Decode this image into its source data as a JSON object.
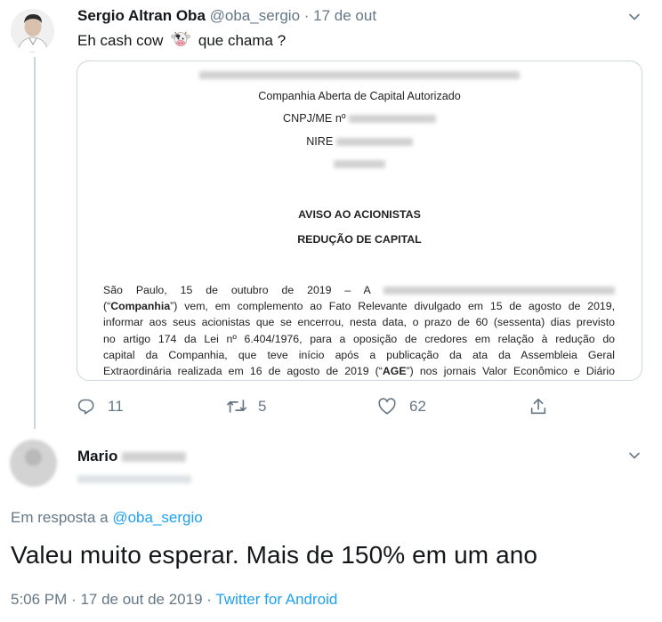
{
  "tweet": {
    "author_name": "Sergio Altran Oba",
    "author_handle": "@oba_sergio",
    "separator": "·",
    "date": "17 de out",
    "text_before": "Eh cash cow",
    "text_emoji": "cow-face-emoji",
    "text_after": "que chama ?",
    "document": {
      "line_company_type": "Companhia Aberta de Capital Autorizado",
      "line_cnpj_label": "CNPJ/ME nº",
      "line_nire_label": "NIRE",
      "heading_1": "AVISO AO ACIONISTAS",
      "heading_2": "REDUÇÃO DE CAPITAL",
      "body_l1_a": "São Paulo, 15 de outubro de 2019 – A",
      "body_l2_open": "(“",
      "body_l2_bold": "Companhia",
      "body_l2_rest": "”) vem, em complemento ao Fato Relevante divulgado em 15 de agosto de 2019,",
      "body_l3": "informar aos seus acionistas que se encerrou, nesta data, o prazo de 60 (sessenta) dias previsto",
      "body_l4": "no artigo 174 da Lei nº 6.404/1976, para a oposição de credores em relação à redução do",
      "body_l5": "capital da Companhia, que teve início após a publicação da ata da Assembleia Geral",
      "body_l6_a": "Extraordinária realizada em 16 de agosto de 2019 (“",
      "body_l6_bold": "AGE",
      "body_l6_b": "”) nos jornais Valor Econômico e Diário"
    },
    "actions": {
      "replies": "11",
      "retweets": "5",
      "likes": "62"
    }
  },
  "reply": {
    "author_name_visible": "Mario",
    "in_reply_prefix": "Em resposta a",
    "in_reply_handle": "@oba_sergio",
    "text": "Valeu muito esperar. Mais de 150% em um ano",
    "time": "5:06 PM",
    "separator": "·",
    "date": "17 de out de 2019",
    "source": "Twitter for Android"
  },
  "colors": {
    "text_primary": "#14171a",
    "text_secondary": "#657786",
    "link": "#1da1f2",
    "border": "#ccd6dd"
  },
  "icons": {
    "reply": "reply-icon",
    "retweet": "retweet-icon",
    "like": "heart-icon",
    "share": "share-icon",
    "menu": "chevron-down-icon"
  }
}
